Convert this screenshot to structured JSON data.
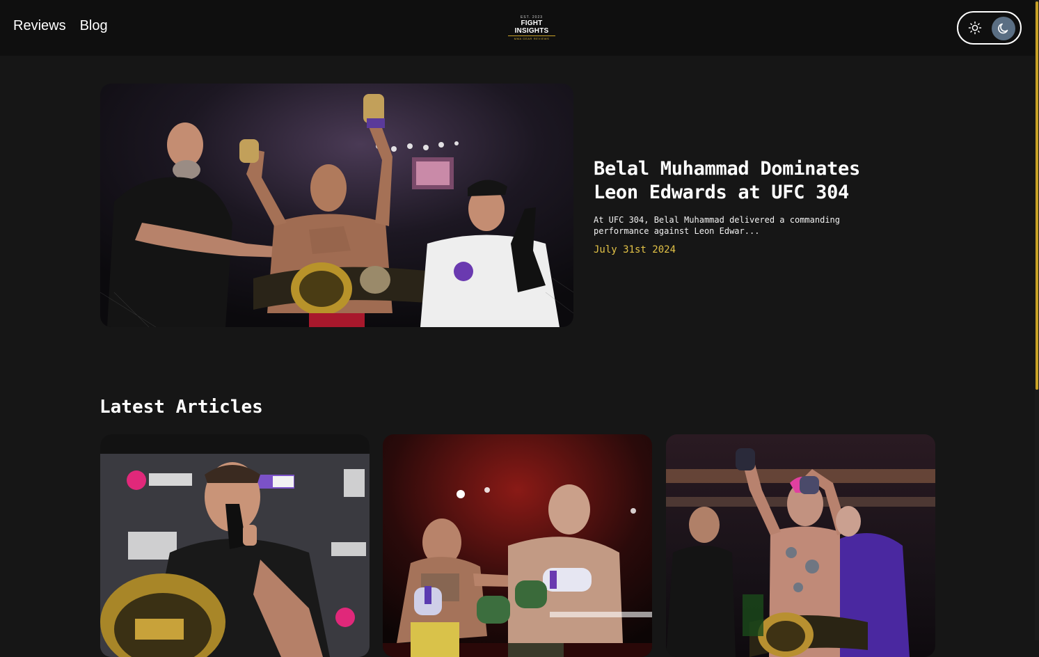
{
  "nav": {
    "items": [
      {
        "label": "Reviews"
      },
      {
        "label": "Blog"
      }
    ]
  },
  "logo": {
    "est": "EST. 2023",
    "name": "FIGHT INSIGHTS",
    "tagline": "MMA GEAR REVIEWS"
  },
  "theme_toggle": {
    "light_icon": "sun-icon",
    "dark_icon": "moon-icon",
    "active": "dark"
  },
  "hero": {
    "title": "Belal Muhammad Dominates Leon Edwards at UFC 304",
    "excerpt": "At UFC 304, Belal Muhammad delivered a commanding performance against Leon Edwar...",
    "date": "July 31st 2024",
    "image": "belal-muhammad-victory-photo"
  },
  "latest": {
    "heading": "Latest Articles",
    "articles": [
      {
        "image": "tom-aspinall-press-conference-photo"
      },
      {
        "image": "usyk-fury-boxing-photo"
      },
      {
        "image": "sean-omalley-victory-photo"
      }
    ]
  },
  "colors": {
    "background": "#161616",
    "header": "#0f0f0f",
    "accent": "#e3c347",
    "toggle_active": "#5a6e83"
  }
}
